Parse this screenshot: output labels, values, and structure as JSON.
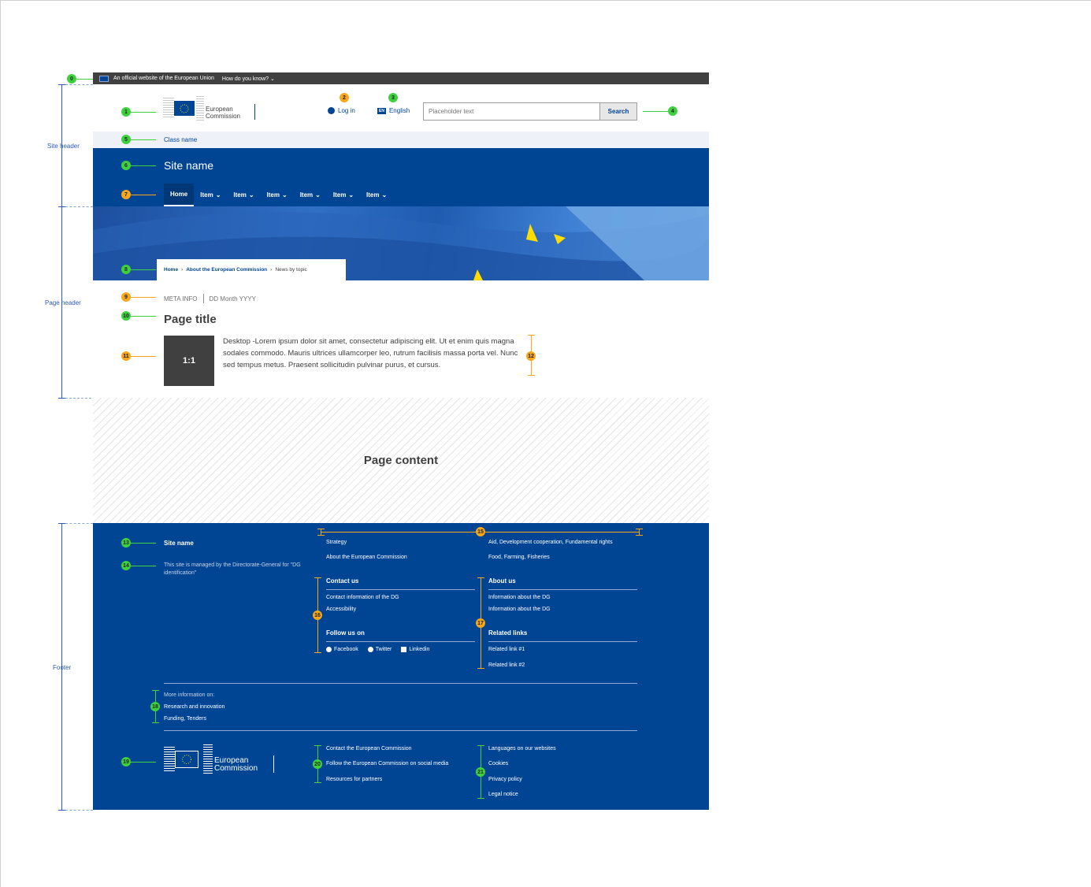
{
  "sections": {
    "site_header": "Site header",
    "page_header": "Page header",
    "footer": "Footer"
  },
  "markers": [
    "0",
    "1",
    "2",
    "3",
    "4",
    "5",
    "6",
    "7",
    "8",
    "9",
    "10",
    "11",
    "12",
    "13",
    "14",
    "15",
    "16",
    "17",
    "18",
    "19",
    "20",
    "21"
  ],
  "topbar": {
    "official_text": "An official website of the European Union",
    "how_text": "How do you know?",
    "chevron": "⌄"
  },
  "header": {
    "logo_line1": "European",
    "logo_line2": "Commission",
    "login_label": "Log in",
    "language_code": "EN",
    "language_label": "English",
    "search_placeholder": "Placeholder text",
    "search_button": "Search"
  },
  "class_name": "Class name",
  "site_name": "Site name",
  "nav": {
    "home": "Home",
    "items": [
      "Item",
      "Item",
      "Item",
      "Item",
      "Item",
      "Item"
    ],
    "chevron": "⌄"
  },
  "breadcrumb": {
    "home": "Home",
    "sep": "›",
    "about": "About the European Commission",
    "current": "News by topic"
  },
  "page": {
    "meta_info": "META INFO",
    "date": "DD Month YYYY",
    "title": "Page title",
    "thumb_ratio": "1:1",
    "intro": "Desktop -Lorem ipsum dolor sit amet, consectetur adipiscing elit. Ut et enim quis magna sodales commodo. Mauris ultrices ullamcorper leo, rutrum facilisis massa porta vel. Nunc sed tempus metus. Praesent sollicitudin pulvinar purus, et cursus."
  },
  "content_label": "Page content",
  "footer": {
    "site_name": "Site name",
    "managed_by": "This site is managed by the Directorate-General for \"DG identification\"",
    "links_col1": [
      "Strategy",
      "About the European Commission"
    ],
    "links_col2": [
      "Aid, Development cooperation, Fundamental rights",
      "Food, Farming, Fisheries"
    ],
    "contact_title": "Contact us",
    "contact_links": [
      "Contact information of the DG",
      "Accessibility"
    ],
    "follow_title": "Follow us on",
    "social": [
      "Facebook",
      "Twitter",
      "Linkedin"
    ],
    "about_title": "About us",
    "about_links": [
      "Information about the DG",
      "Information about the DG"
    ],
    "related_title": "Related links",
    "related_links": [
      "Related link #1",
      "Related link #2"
    ],
    "more_info_label": "More information on:",
    "more_info_links": [
      "Research and innovation",
      "Funding, Tenders"
    ],
    "logo_line1": "European",
    "logo_line2": "Commission",
    "bottom_col1": [
      "Contact the European Commission",
      "Follow the European Commission on social media",
      "Resources for partners"
    ],
    "bottom_col2": [
      "Languages on our websites",
      "Cookies",
      "Privacy policy",
      "Legal notice"
    ]
  },
  "colors": {
    "ec_blue": "#004494",
    "green_marker": "#3ed13e",
    "orange_marker": "#f6a71a",
    "topbar": "#404040"
  }
}
